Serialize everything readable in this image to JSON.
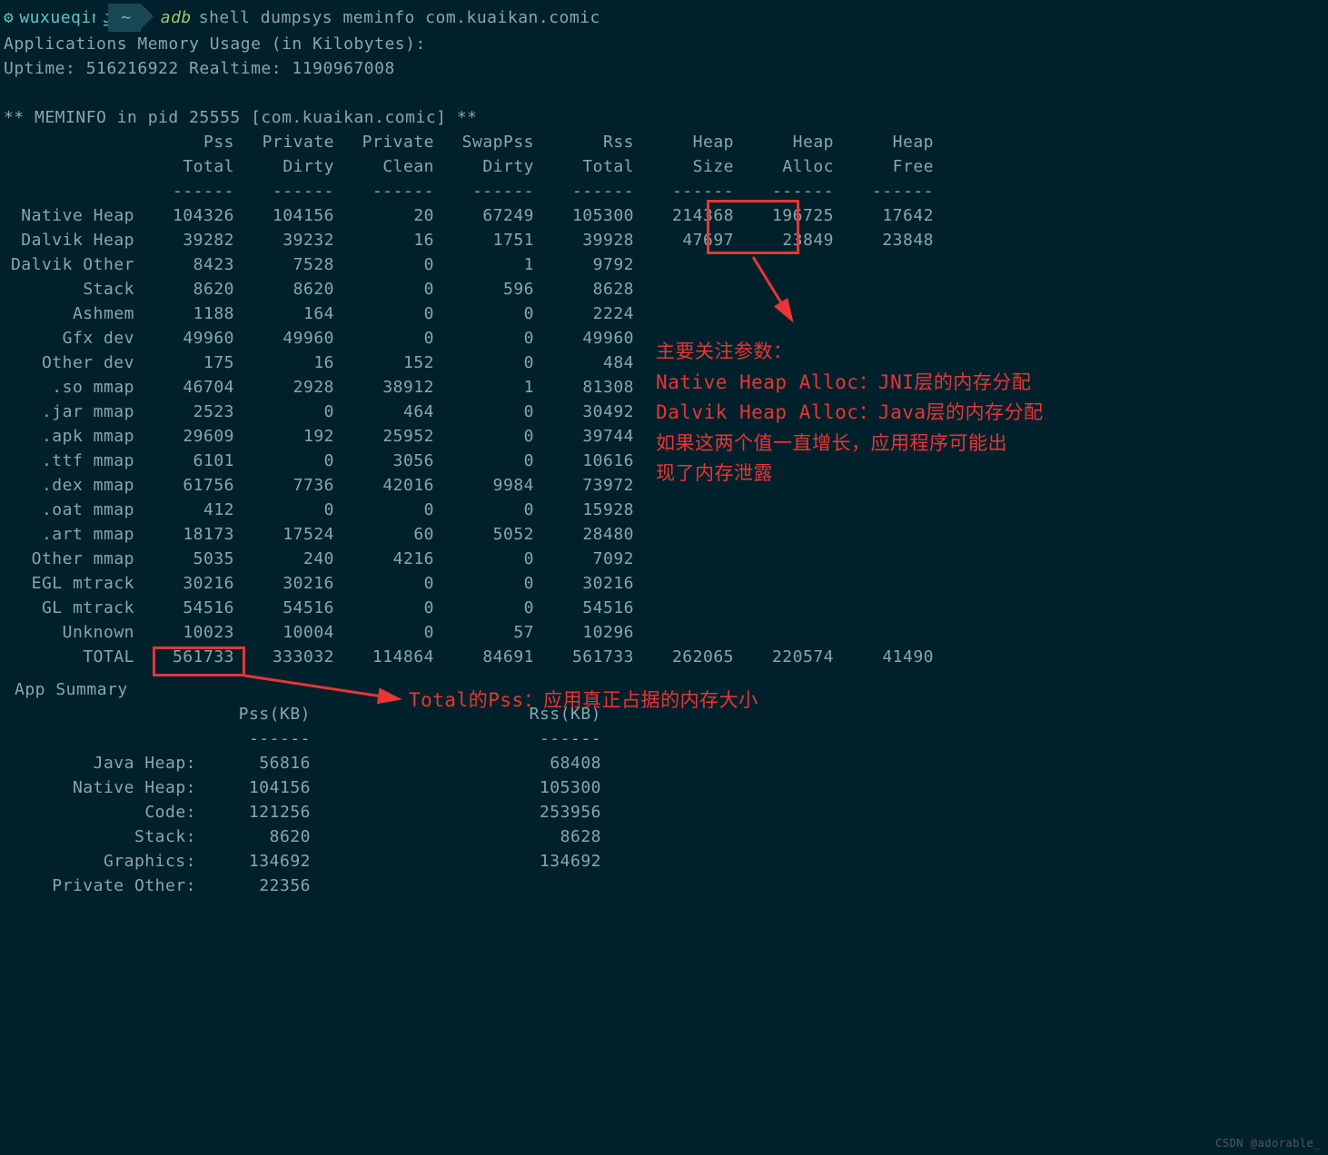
{
  "prompt": {
    "user": "wuxueqing",
    "path": "~",
    "cmd_adb": "adb",
    "cmd_rest": "shell dumpsys meminfo com.kuaikan.comic"
  },
  "header": {
    "line1": "Applications Memory Usage (in Kilobytes):",
    "line2": "Uptime: 516216922 Realtime: 1190967008",
    "meminfo": "** MEMINFO in pid 25555 [com.kuaikan.comic] **"
  },
  "cols": {
    "h1": [
      "Pss",
      "Private",
      "Private",
      "SwapPss",
      "Rss",
      "Heap",
      "Heap",
      "Heap"
    ],
    "h2": [
      "Total",
      "Dirty",
      "Clean",
      "Dirty",
      "Total",
      "Size",
      "Alloc",
      "Free"
    ],
    "dash": "------"
  },
  "rows": [
    {
      "label": "Native Heap",
      "vals": [
        "104326",
        "104156",
        "20",
        "67249",
        "105300",
        "214368",
        "196725",
        "17642"
      ]
    },
    {
      "label": "Dalvik Heap",
      "vals": [
        "39282",
        "39232",
        "16",
        "1751",
        "39928",
        "47697",
        "23849",
        "23848"
      ]
    },
    {
      "label": "Dalvik Other",
      "vals": [
        "8423",
        "7528",
        "0",
        "1",
        "9792",
        "",
        "",
        ""
      ]
    },
    {
      "label": "Stack",
      "vals": [
        "8620",
        "8620",
        "0",
        "596",
        "8628",
        "",
        "",
        ""
      ]
    },
    {
      "label": "Ashmem",
      "vals": [
        "1188",
        "164",
        "0",
        "0",
        "2224",
        "",
        "",
        ""
      ]
    },
    {
      "label": "Gfx dev",
      "vals": [
        "49960",
        "49960",
        "0",
        "0",
        "49960",
        "",
        "",
        ""
      ]
    },
    {
      "label": "Other dev",
      "vals": [
        "175",
        "16",
        "152",
        "0",
        "484",
        "",
        "",
        ""
      ]
    },
    {
      "label": ".so mmap",
      "vals": [
        "46704",
        "2928",
        "38912",
        "1",
        "81308",
        "",
        "",
        ""
      ]
    },
    {
      "label": ".jar mmap",
      "vals": [
        "2523",
        "0",
        "464",
        "0",
        "30492",
        "",
        "",
        ""
      ]
    },
    {
      "label": ".apk mmap",
      "vals": [
        "29609",
        "192",
        "25952",
        "0",
        "39744",
        "",
        "",
        ""
      ]
    },
    {
      "label": ".ttf mmap",
      "vals": [
        "6101",
        "0",
        "3056",
        "0",
        "10616",
        "",
        "",
        ""
      ]
    },
    {
      "label": ".dex mmap",
      "vals": [
        "61756",
        "7736",
        "42016",
        "9984",
        "73972",
        "",
        "",
        ""
      ]
    },
    {
      "label": ".oat mmap",
      "vals": [
        "412",
        "0",
        "0",
        "0",
        "15928",
        "",
        "",
        ""
      ]
    },
    {
      "label": ".art mmap",
      "vals": [
        "18173",
        "17524",
        "60",
        "5052",
        "28480",
        "",
        "",
        ""
      ]
    },
    {
      "label": "Other mmap",
      "vals": [
        "5035",
        "240",
        "4216",
        "0",
        "7092",
        "",
        "",
        ""
      ]
    },
    {
      "label": "EGL mtrack",
      "vals": [
        "30216",
        "30216",
        "0",
        "0",
        "30216",
        "",
        "",
        ""
      ]
    },
    {
      "label": "GL mtrack",
      "vals": [
        "54516",
        "54516",
        "0",
        "0",
        "54516",
        "",
        "",
        ""
      ]
    },
    {
      "label": "Unknown",
      "vals": [
        "10023",
        "10004",
        "0",
        "57",
        "10296",
        "",
        "",
        ""
      ]
    },
    {
      "label": "TOTAL",
      "vals": [
        "561733",
        "333032",
        "114864",
        "84691",
        "561733",
        "262065",
        "220574",
        "41490"
      ]
    }
  ],
  "annotation1": {
    "l1": "主要关注参数：",
    "l2": "Native Heap Alloc：JNI层的内存分配",
    "l3": "Dalvik Heap Alloc：Java层的内存分配",
    "l4": "如果这两个值一直增长，应用程序可能出",
    "l5": "现了内存泄露"
  },
  "annotation2": "Total的Pss：应用真正占据的内存大小",
  "summary": {
    "title": "App Summary",
    "pssh": "Pss(KB)",
    "rssh": "Rss(KB)",
    "dash": "------",
    "rows": [
      {
        "label": "Java Heap:",
        "pss": "56816",
        "rss": "68408"
      },
      {
        "label": "Native Heap:",
        "pss": "104156",
        "rss": "105300"
      },
      {
        "label": "Code:",
        "pss": "121256",
        "rss": "253956"
      },
      {
        "label": "Stack:",
        "pss": "8620",
        "rss": "8628"
      },
      {
        "label": "Graphics:",
        "pss": "134692",
        "rss": "134692"
      },
      {
        "label": "Private Other:",
        "pss": "22356",
        "rss": ""
      }
    ]
  },
  "watermark": "CSDN @adorable_"
}
